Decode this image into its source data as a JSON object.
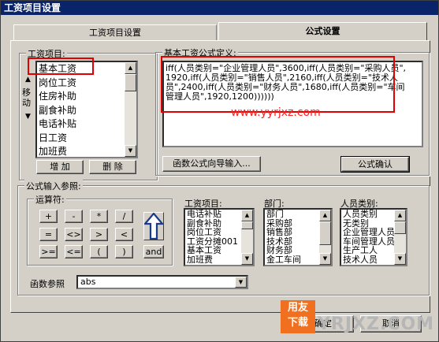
{
  "window": {
    "title": "工资项目设置"
  },
  "tabs": [
    {
      "label": "工资项目设置"
    },
    {
      "label": "公式设置"
    }
  ],
  "salary_items": {
    "legend": "工资项目:",
    "items": [
      "基本工资",
      "岗位工资",
      "住房补助",
      "副食补助",
      "电话补贴",
      "日工资",
      "加班费"
    ],
    "selected": "基本工资",
    "move_label": "移动",
    "add_button": "增 加",
    "delete_button": "删 除"
  },
  "formula_def": {
    "legend": "基本工资公式定义:",
    "text": "iff(人员类别=\"企业管理人员\",3600,iff(人员类别=\"采购人员\",1920,iff(人员类别=\"销售人员\",2160,iff(人员类别=\"技术人员\",2400,iff(人员类别=\"财务人员\",1680,iff(人员类别=\"车间管理人员\",1920,1200))))))",
    "wizard_button": "函数公式向导输入...",
    "confirm_button": "公式确认"
  },
  "watermark": "www.yyrjxz.com",
  "formula_ref": {
    "legend": "公式输入参照:",
    "operators_legend": "运算符:",
    "operators": [
      "+",
      "-",
      "*",
      "/",
      "=",
      "<>",
      ">",
      "<",
      ">=",
      "<=",
      "(",
      ")",
      "and"
    ],
    "func_label": "函数参照",
    "func_value": "abs"
  },
  "ref_salary": {
    "label": "工资项目:",
    "items": [
      "电话补贴",
      "副食补助",
      "岗位工资",
      "工资分摊001",
      "基本工资",
      "加班费"
    ]
  },
  "ref_dept": {
    "label": "部门:",
    "items": [
      "部门",
      "采购部",
      "销售部",
      "技术部",
      "财务部",
      "金工车间"
    ]
  },
  "ref_category": {
    "label": "人员类别:",
    "items": [
      "人员类别",
      "无类别",
      "企业管理人员",
      "车间管理人员",
      "生产工人",
      "技术人员"
    ]
  },
  "bottom": {
    "ok_button": "确定",
    "cancel_button": "取消",
    "logo_text1": "用友",
    "logo_text2": "下载",
    "brand": "YRJXZ.COM"
  }
}
